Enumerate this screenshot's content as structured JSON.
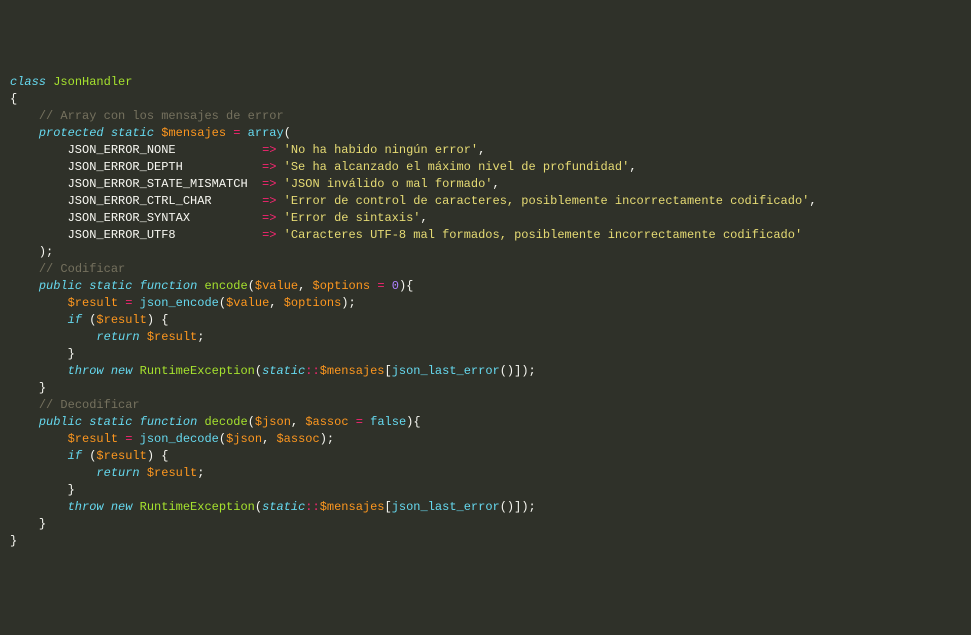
{
  "code": {
    "class_kw": "class",
    "class_name": "JsonHandler",
    "lbrace": "{",
    "rbrace": "}",
    "comment_array": "// Array con los mensajes de error",
    "protected": "protected",
    "static": "static",
    "var_mensajes": "$mensajes",
    "eq": "=",
    "array_kw": "array",
    "arrow": "=>",
    "errors": [
      {
        "const": "JSON_ERROR_NONE",
        "pad": "           ",
        "msg": "'No ha habido ningún error'"
      },
      {
        "const": "JSON_ERROR_DEPTH",
        "pad": "          ",
        "msg": "'Se ha alcanzado el máximo nivel de profundidad'"
      },
      {
        "const": "JSON_ERROR_STATE_MISMATCH",
        "pad": " ",
        "msg": "'JSON inválido o mal formado'"
      },
      {
        "const": "JSON_ERROR_CTRL_CHAR",
        "pad": "      ",
        "msg": "'Error de control de caracteres, posiblemente incorrectamente codificado'"
      },
      {
        "const": "JSON_ERROR_SYNTAX",
        "pad": "         ",
        "msg": "'Error de sintaxis'"
      },
      {
        "const": "JSON_ERROR_UTF8",
        "pad": "           ",
        "msg": "'Caracteres UTF-8 mal formados, posiblemente incorrectamente codificado'"
      }
    ],
    "comment_encode": "// Codificar",
    "public": "public",
    "function": "function",
    "encode_name": "encode",
    "param_value": "$value",
    "param_options": "$options",
    "zero": "0",
    "var_result": "$result",
    "json_encode": "json_encode",
    "if": "if",
    "return": "return",
    "throw": "throw",
    "new": "new",
    "runtime_exc": "RuntimeException",
    "static_scope": "static",
    "scope_op": "::",
    "json_last_error": "json_last_error",
    "comment_decode": "// Decodificar",
    "decode_name": "decode",
    "param_json": "$json",
    "param_assoc": "$assoc",
    "false": "false",
    "json_decode": "json_decode"
  }
}
